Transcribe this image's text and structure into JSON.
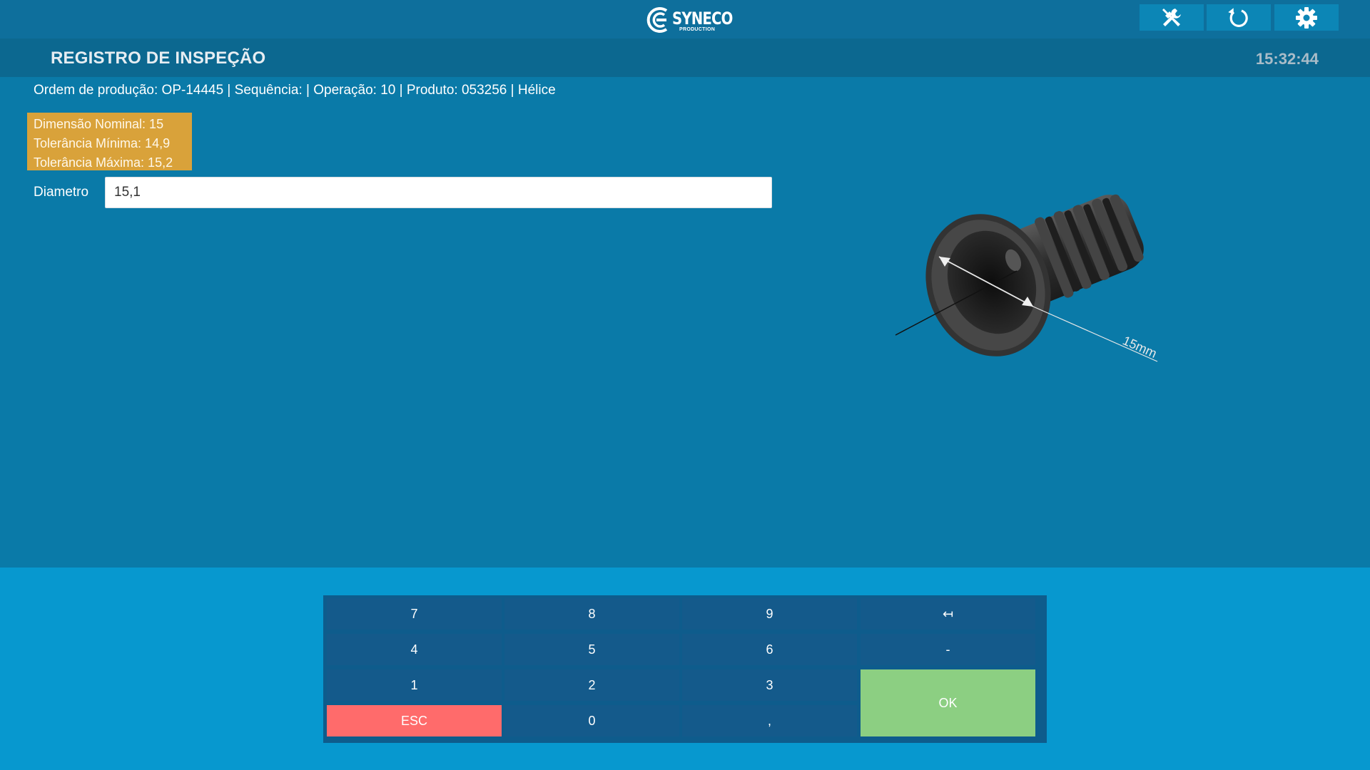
{
  "header": {
    "logo_text": "SYNECO",
    "logo_subtext": "PRODUCTION",
    "buttons": [
      {
        "icon": "tools-icon"
      },
      {
        "icon": "refresh-icon"
      },
      {
        "icon": "gear-icon"
      }
    ]
  },
  "titlebar": {
    "title": "REGISTRO DE INSPEÇÃO",
    "time": "15:32:44"
  },
  "order_info": "Ordem de produção: OP-14445 | Sequência: | Operação: 10 | Produto: 053256 | Hélice",
  "tolerances": {
    "nominal": "Dimensão Nominal: 15",
    "min": "Tolerância Mínima: 14,9",
    "max": "Tolerância Máxima: 15,2"
  },
  "measurement": {
    "label": "Diametro",
    "value": "15,1"
  },
  "image": {
    "dimension_label": "15mm"
  },
  "keypad": {
    "k7": "7",
    "k8": "8",
    "k9": "9",
    "backspace": "↤",
    "k4": "4",
    "k5": "5",
    "k6": "6",
    "minus": "-",
    "k1": "1",
    "k2": "2",
    "k3": "3",
    "ok": "OK",
    "esc": "ESC",
    "k0": "0",
    "comma": ","
  },
  "colors": {
    "background": "#0a7aa8",
    "tolerance_box": "#d9a23a",
    "esc_key": "#ff6b6b",
    "ok_key": "#8ccf82"
  }
}
